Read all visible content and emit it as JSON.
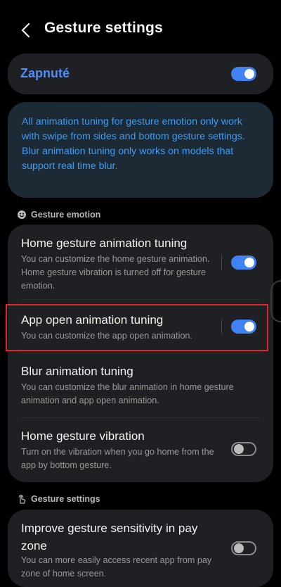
{
  "header": {
    "title": "Gesture settings"
  },
  "master": {
    "label": "Zapnuté",
    "enabled": true
  },
  "info": {
    "text": "All animation tuning for gesture emotion only work with swipe from sides and bottom gesture settings.\nBlur animation tuning only works on models that support real time blur."
  },
  "sections": [
    {
      "title": "Gesture emotion",
      "icon": "smiley-icon",
      "items": [
        {
          "title": "Home gesture animation tuning",
          "description": "You can customize the home gesture animation. Home gesture vibration is turned off for gesture emotion.",
          "enabled": true
        },
        {
          "title": "App open animation tuning",
          "description": "You can customize the app open animation.",
          "enabled": true
        },
        {
          "title": "Blur animation tuning",
          "description": "You can customize the blur animation in home gesture animation and app open animation."
        },
        {
          "title": "Home gesture vibration",
          "description": "Turn on the vibration when you go home from the app by bottom gesture.",
          "enabled": false
        }
      ]
    },
    {
      "title": "Gesture settings",
      "icon": "gesture-hand-icon",
      "items": [
        {
          "title": "Improve gesture sensitivity in pay zone",
          "description": "You can more easily access recent app from pay zone of home screen.",
          "enabled": false
        }
      ]
    }
  ],
  "colors": {
    "accent": "#3f82f3",
    "info_text": "#3f9bf1",
    "highlight": "#e0262a",
    "background": "#000000",
    "card": "#1f2023"
  }
}
